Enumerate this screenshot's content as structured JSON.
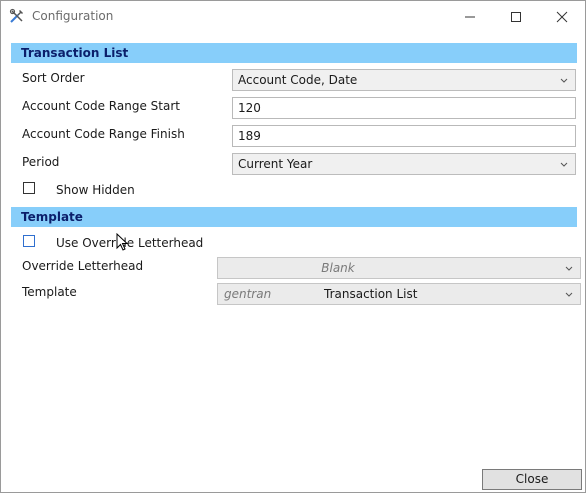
{
  "window": {
    "title": "Configuration",
    "app_icon": "tools-icon",
    "controls": [
      "minimize-icon",
      "maximize-icon",
      "close-icon"
    ]
  },
  "transaction_list": {
    "header": "Transaction List",
    "sort_order": {
      "label": "Sort Order",
      "value": "Account Code, Date"
    },
    "range_start": {
      "label": "Account Code Range Start",
      "value": "120"
    },
    "range_finish": {
      "label": "Account Code Range Finish",
      "value": "189"
    },
    "period": {
      "label": "Period",
      "value": "Current Year"
    },
    "show_hidden": {
      "label": "Show Hidden",
      "checked": false
    }
  },
  "template_section": {
    "header": "Template",
    "use_override": {
      "label": "Use Override Letterhead",
      "checked": false
    },
    "override_letterhead": {
      "label": "Override Letterhead",
      "value": "Blank"
    },
    "template": {
      "label": "Template",
      "source": "gentran",
      "value": "Transaction List"
    }
  },
  "footer": {
    "close_label": "Close"
  },
  "colors": {
    "section_header_bg": "#87cefa",
    "section_header_text": "#0b1f6b"
  }
}
